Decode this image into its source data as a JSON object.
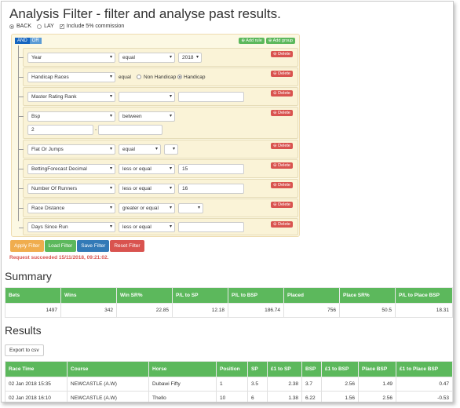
{
  "title": "Analysis Filter - filter and analyse past results.",
  "modes": {
    "back": "BACK",
    "lay": "LAY",
    "commission": "Include 5% commission"
  },
  "builder": {
    "and": "AND",
    "or": "OR",
    "add_rule": "Add rule",
    "add_group": "Add group",
    "delete": "Delete",
    "rules": [
      {
        "field": "Year",
        "operator": "equal",
        "value": "2018"
      },
      {
        "field": "Handicap Races",
        "operator": "equal",
        "opt1": "Non Handicap",
        "opt2": "Handicap"
      },
      {
        "field": "Master Rating Rank",
        "operator": "",
        "value": ""
      },
      {
        "field": "Bsp",
        "operator": "between",
        "value": "2",
        "value2": ""
      },
      {
        "field": "Flat Or Jumps",
        "operator": "equal",
        "value": ""
      },
      {
        "field": "BettingForecast Decimal",
        "operator": "less or equal",
        "value": "15"
      },
      {
        "field": "Number Of Runners",
        "operator": "less or equal",
        "value": "16"
      },
      {
        "field": "Race Distance",
        "operator": "greater or equal",
        "value": ""
      },
      {
        "field": "Days Since Run",
        "operator": "less or equal",
        "value": ""
      }
    ]
  },
  "actions": {
    "apply": "Apply Filter",
    "load": "Load Filter",
    "save": "Save Filter",
    "reset": "Reset Filter"
  },
  "status": "Request succeeded 15/11/2018, 09:21:02.",
  "summary": {
    "heading": "Summary",
    "columns": [
      "Bets",
      "Wins",
      "Win SR%",
      "P/L to SP",
      "P/L to BSP",
      "Placed",
      "Place SR%",
      "P/L to Place BSP"
    ],
    "row": [
      "1497",
      "342",
      "22.85",
      "12.18",
      "186.74",
      "756",
      "50.5",
      "18.31"
    ]
  },
  "results": {
    "heading": "Results",
    "export": "Export to csv",
    "columns": [
      "Race Time",
      "Course",
      "Horse",
      "Position",
      "SP",
      "£1 to SP",
      "BSP",
      "£1 to BSP",
      "Place BSP",
      "£1 to Place BSP"
    ],
    "rows": [
      [
        "02 Jan 2018 15:35",
        "NEWCASTLE (A.W)",
        "Dubawi Fifty",
        "1",
        "3.5",
        "2.38",
        "3.7",
        "2.56",
        "1.49",
        "0.47"
      ],
      [
        "02 Jan 2018 16:10",
        "NEWCASTLE (A.W)",
        "Thello",
        "10",
        "6",
        "1.38",
        "6.22",
        "1.56",
        "2.56",
        "-0.53"
      ]
    ]
  }
}
